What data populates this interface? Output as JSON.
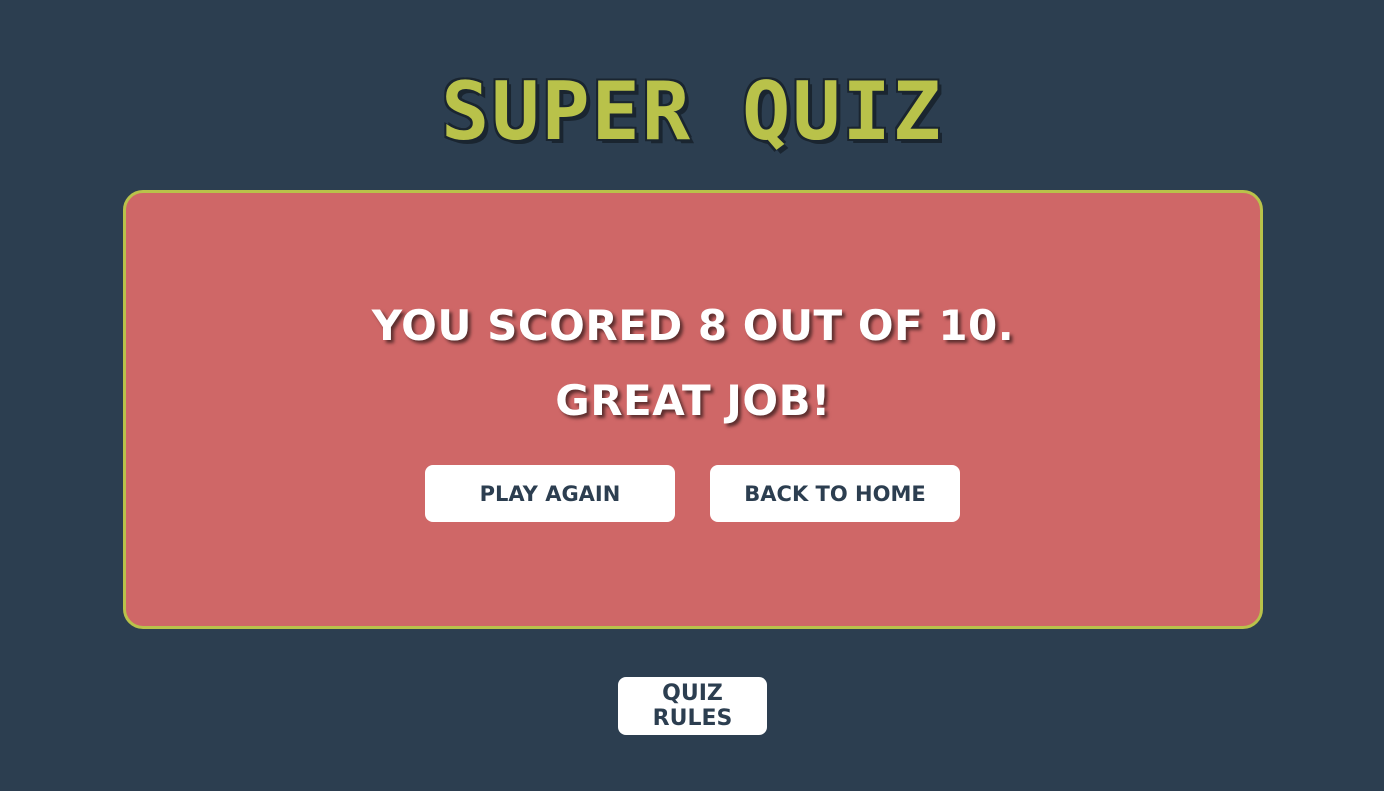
{
  "header": {
    "logo_text": "SUPER QUIZ"
  },
  "result": {
    "score_text": "You scored 8 out of 10.",
    "message": "Great job!",
    "play_again_label": "Play again",
    "back_home_label": "Back to home"
  },
  "footer": {
    "rules_label": "Quiz rules"
  },
  "colors": {
    "background": "#2c3e50",
    "accent": "#b9c24a",
    "card": "#cf6767",
    "button": "#ffffff",
    "button_text": "#2c3e50"
  }
}
